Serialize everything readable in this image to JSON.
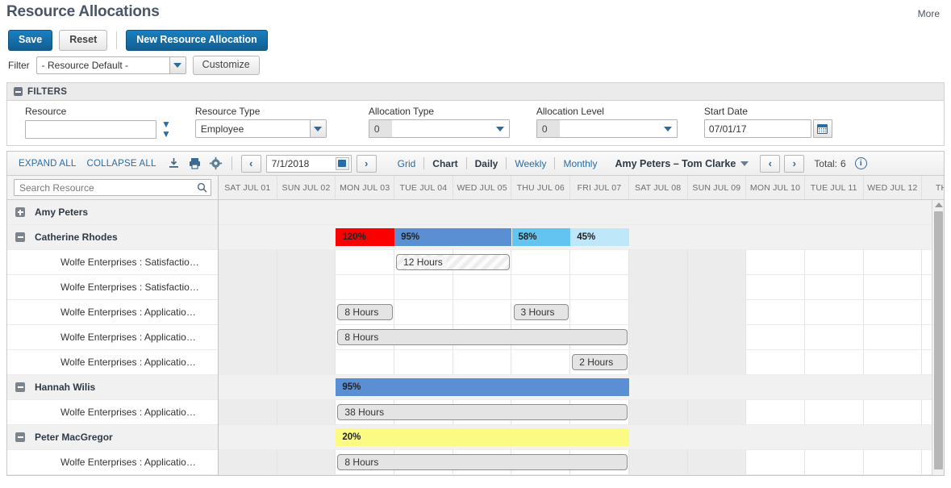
{
  "header": {
    "title": "Resource Allocations",
    "more_label": "More"
  },
  "actions": {
    "save_label": "Save",
    "reset_label": "Reset",
    "new_label": "New Resource Allocation"
  },
  "filter_row": {
    "label": "Filter",
    "selected": "- Resource Default -",
    "customize_label": "Customize"
  },
  "filters_panel": {
    "title": "FILTERS",
    "fields": [
      {
        "label": "Resource",
        "value": "",
        "type": "lookup"
      },
      {
        "label": "Resource Type",
        "value": "Employee",
        "type": "select"
      },
      {
        "label": "Allocation Type",
        "value": "0",
        "type": "multi"
      },
      {
        "label": "Allocation Level",
        "value": "0",
        "type": "multi"
      },
      {
        "label": "Start Date",
        "value": "07/01/17",
        "type": "date"
      }
    ]
  },
  "gantt_toolbar": {
    "expand_all": "EXPAND ALL",
    "collapse_all": "COLLAPSE ALL",
    "icons": [
      "download-icon",
      "print-icon",
      "gear-icon"
    ],
    "prev_label": "‹",
    "next_label": "›",
    "date_value": "7/1/2018",
    "views": [
      {
        "label": "Grid",
        "active": false
      },
      {
        "label": "Chart",
        "active": true
      }
    ],
    "periods": [
      {
        "label": "Daily",
        "active": true
      },
      {
        "label": "Weekly",
        "active": false
      },
      {
        "label": "Monthly",
        "active": false
      }
    ],
    "range_label": "Amy Peters – Tom Clarke",
    "total_label": "Total:",
    "total_value": "6",
    "info_glyph": "i"
  },
  "grid": {
    "search_placeholder": "Search Resource",
    "search_value": "",
    "dates": [
      "SAT JUL 01",
      "SUN JUL 02",
      "MON JUL 03",
      "TUE JUL 04",
      "WED JUL 05",
      "THU JUL 06",
      "FRI JUL 07",
      "SAT JUL 08",
      "SUN JUL 09",
      "MON JUL 10",
      "TUE JUL 11",
      "WED JUL 12",
      "THU JU"
    ],
    "weekend_columns": [
      0,
      1,
      7,
      8
    ],
    "rows": [
      {
        "name": "Amy Peters",
        "type": "group",
        "expanded": false,
        "bars": []
      },
      {
        "name": "Catherine Rhodes",
        "type": "group",
        "expanded": true,
        "bars": [
          {
            "label": "120%",
            "start": 2,
            "span": 1,
            "color": "#fa0000"
          },
          {
            "label": "95%",
            "start": 3,
            "span": 2,
            "color": "#5b8fd4"
          },
          {
            "label": "58%",
            "start": 5,
            "span": 1,
            "color": "#62c4ef"
          },
          {
            "label": "45%",
            "start": 6,
            "span": 1,
            "color": "#bfe7fa"
          }
        ]
      },
      {
        "name": "Wolfe Enterprises : Satisfactio…",
        "type": "child",
        "bars": [
          {
            "label": "12 Hours",
            "start": 3,
            "span": 2,
            "style": "striped"
          }
        ]
      },
      {
        "name": "Wolfe Enterprises : Satisfactio…",
        "type": "child",
        "bars": []
      },
      {
        "name": "Wolfe Enterprises : Applicatio…",
        "type": "child",
        "bars": [
          {
            "label": "8 Hours",
            "start": 2,
            "span": 1,
            "style": "plain"
          },
          {
            "label": "3 Hours",
            "start": 5,
            "span": 1,
            "style": "plain"
          }
        ]
      },
      {
        "name": "Wolfe Enterprises : Applicatio…",
        "type": "child",
        "bars": [
          {
            "label": "8 Hours",
            "start": 2,
            "span": 5,
            "style": "plain"
          }
        ]
      },
      {
        "name": "Wolfe Enterprises : Applicatio…",
        "type": "child",
        "bars": [
          {
            "label": "2 Hours",
            "start": 6,
            "span": 1,
            "style": "plain"
          }
        ]
      },
      {
        "name": "Hannah Wilis",
        "type": "group",
        "expanded": true,
        "bars": [
          {
            "label": "95%",
            "start": 2,
            "span": 5,
            "color": "#5b8fd4"
          }
        ]
      },
      {
        "name": "Wolfe Enterprises : Applicatio…",
        "type": "child",
        "bars": [
          {
            "label": "38 Hours",
            "start": 2,
            "span": 5,
            "style": "plain"
          }
        ]
      },
      {
        "name": "Peter MacGregor",
        "type": "group",
        "expanded": true,
        "bars": [
          {
            "label": "20%",
            "start": 2,
            "span": 5,
            "color": "#fbfb84"
          }
        ]
      },
      {
        "name": "Wolfe Enterprises : Applicatio…",
        "type": "child",
        "bars": [
          {
            "label": "8 Hours",
            "start": 2,
            "span": 5,
            "style": "plain"
          }
        ]
      }
    ]
  },
  "colors": {
    "accent": "#2b6ca3",
    "primary_button": "#125e91",
    "over_allocated": "#fa0000",
    "allocated": "#5b8fd4",
    "medium": "#62c4ef",
    "light": "#bfe7fa",
    "low": "#fbfb84"
  }
}
